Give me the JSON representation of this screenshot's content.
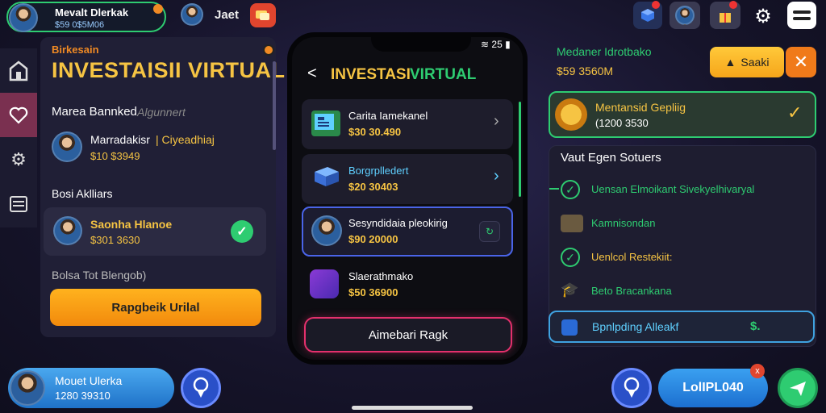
{
  "profile": {
    "name": "Mevalt Dlerkak",
    "balance": "$59 0$5M06"
  },
  "top_center_label": "Jaet",
  "left_panel": {
    "kicker": "Birkesain",
    "title": "INVESTAISII VIRTUAL",
    "section1_label": "Marea Bannked",
    "section1_hint": "Algunnert",
    "featured_name": "Marradakisr",
    "featured_tag": "| Ciyeadhiaj",
    "featured_value": "$10 $3949",
    "section2_label": "Bosi Aklliars",
    "holding_name": "Saonha Hlanoe",
    "holding_value": "$301 3630",
    "footer_hint": "Bolsa Tot Blengob)",
    "cta_label": "Rapgbeik Urilal"
  },
  "phone": {
    "status": "25",
    "back": "<",
    "title_word1": "INVESTASI",
    "title_word2": "VIRTUAL",
    "rows": [
      {
        "title": "Carita Iamekanel",
        "value": "$30 30.490"
      },
      {
        "title": "Borgrplledert",
        "value": "$20 30403"
      },
      {
        "title": "Sesyndidaia pleokirig",
        "value": "$90 20000"
      },
      {
        "title": "Slaerathmako",
        "value": "$50 36900"
      }
    ],
    "cta_label": "Aimebari Ragk"
  },
  "right_panel": {
    "header_name": "Medaner Idrotbako",
    "header_value": "$59 3560M",
    "save_label": "Saaki",
    "green_card_title": "Mentansid Gepliig",
    "green_card_value": "(1200 3530",
    "list_title": "Vaut Egen Sotuers",
    "items": [
      {
        "label": "Uensan Elmoikant Sivekyelhivaryal"
      },
      {
        "label": "Kamnisondan"
      },
      {
        "label": "Uenlcol Restekiit:"
      },
      {
        "label": "Beto Bracankana"
      }
    ],
    "blue_row_label": "Bpnlpding Alleakf",
    "blue_row_tail": "$."
  },
  "bottom": {
    "user_name": "Mouet Ulerka",
    "user_value": "1280 39310",
    "pill_label": "LolIPL040",
    "pill_badge": "x"
  },
  "colors": {
    "accent_yellow": "#f6c443",
    "accent_green": "#2ecc71",
    "accent_pink": "#e4306c",
    "accent_blue": "#3fa2e0"
  }
}
